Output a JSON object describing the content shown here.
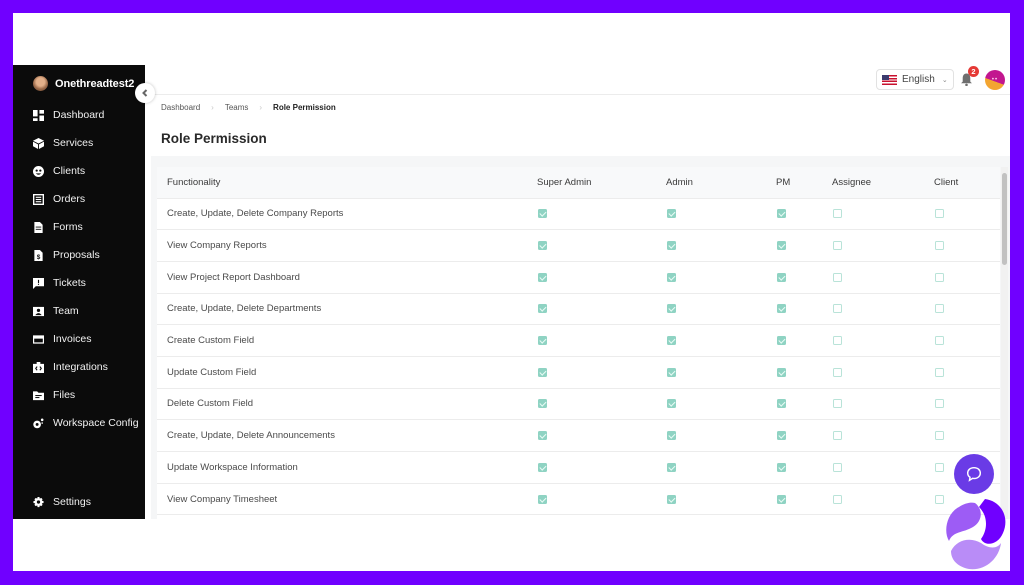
{
  "colors": {
    "frame": "#7000ff",
    "sidebar_bg": "#0b0b0b",
    "checkbox_checked": "#8fd3c3",
    "checkbox_unchecked_border": "#b9e3d8",
    "notification_badge": "#e53935",
    "chat_button": "#6a3be6"
  },
  "sidebar": {
    "workspace_name": "Onethreadtest2",
    "items": [
      {
        "label": "Dashboard",
        "icon": "dashboard-icon"
      },
      {
        "label": "Services",
        "icon": "box-icon"
      },
      {
        "label": "Clients",
        "icon": "clients-icon"
      },
      {
        "label": "Orders",
        "icon": "orders-icon"
      },
      {
        "label": "Forms",
        "icon": "file-icon"
      },
      {
        "label": "Proposals",
        "icon": "proposal-icon"
      },
      {
        "label": "Tickets",
        "icon": "ticket-icon"
      },
      {
        "label": "Team",
        "icon": "team-icon"
      },
      {
        "label": "Invoices",
        "icon": "credit-card-icon"
      },
      {
        "label": "Integrations",
        "icon": "integration-icon"
      },
      {
        "label": "Files",
        "icon": "folder-icon"
      },
      {
        "label": "Workspace Config",
        "icon": "gears-icon"
      }
    ],
    "settings_label": "Settings"
  },
  "header": {
    "language": "English",
    "notification_count": "2"
  },
  "breadcrumb": [
    "Dashboard",
    "Teams",
    "Role Permission"
  ],
  "page_title": "Role Permission",
  "table": {
    "columns": [
      "Functionality",
      "Super Admin",
      "Admin",
      "PM",
      "Assignee",
      "Client"
    ],
    "rows": [
      {
        "functionality": "Create, Update, Delete Company Reports",
        "super_admin": true,
        "admin": true,
        "pm": true,
        "assignee": false,
        "client": false
      },
      {
        "functionality": "View Company Reports",
        "super_admin": true,
        "admin": true,
        "pm": true,
        "assignee": false,
        "client": false
      },
      {
        "functionality": "View Project Report Dashboard",
        "super_admin": true,
        "admin": true,
        "pm": true,
        "assignee": false,
        "client": false
      },
      {
        "functionality": "Create, Update, Delete Departments",
        "super_admin": true,
        "admin": true,
        "pm": true,
        "assignee": false,
        "client": false
      },
      {
        "functionality": "Create Custom Field",
        "super_admin": true,
        "admin": true,
        "pm": true,
        "assignee": false,
        "client": false
      },
      {
        "functionality": "Update Custom Field",
        "super_admin": true,
        "admin": true,
        "pm": true,
        "assignee": false,
        "client": false
      },
      {
        "functionality": "Delete Custom Field",
        "super_admin": true,
        "admin": true,
        "pm": true,
        "assignee": false,
        "client": false
      },
      {
        "functionality": "Create, Update, Delete Announcements",
        "super_admin": true,
        "admin": true,
        "pm": true,
        "assignee": false,
        "client": false
      },
      {
        "functionality": "Update Workspace Information",
        "super_admin": true,
        "admin": true,
        "pm": true,
        "assignee": false,
        "client": false
      },
      {
        "functionality": "View Company Timesheet",
        "super_admin": true,
        "admin": true,
        "pm": true,
        "assignee": false,
        "client": false
      }
    ]
  }
}
